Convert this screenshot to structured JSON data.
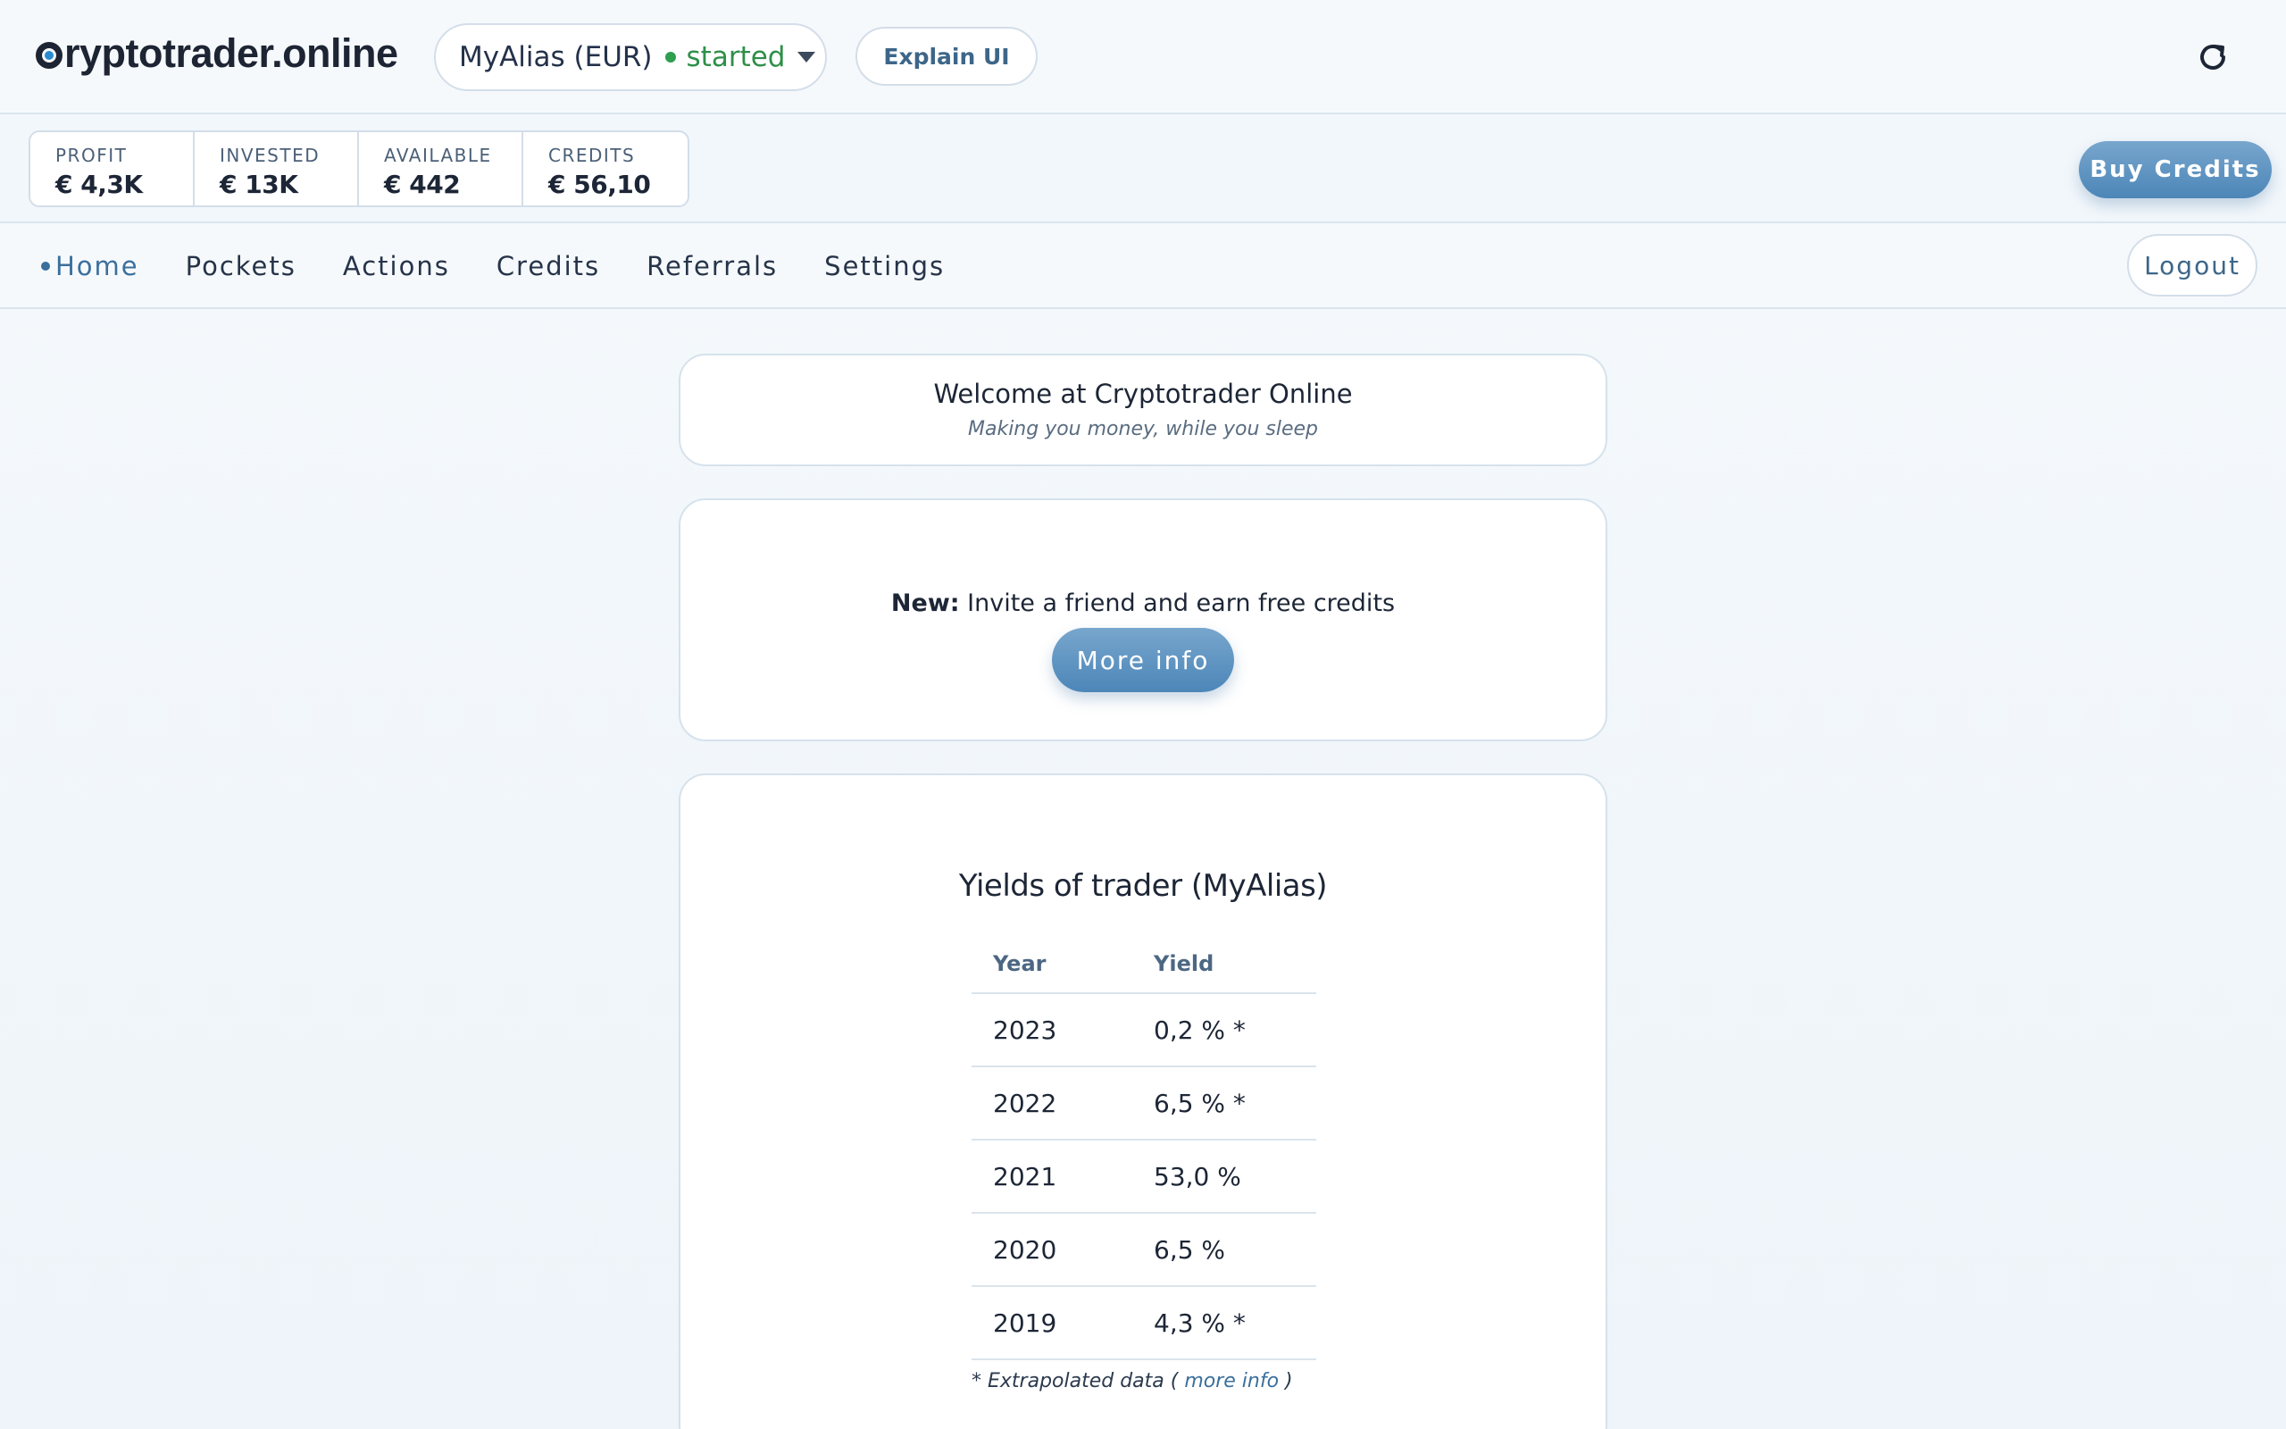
{
  "header": {
    "logo_prefix": "C",
    "logo_rest": "ryptotrader.online",
    "trader_alias": "MyAlias (EUR)",
    "trader_status": "started",
    "explain_label": "Explain UI"
  },
  "stats": [
    {
      "label": "PROFIT",
      "value": "€ 4,3K"
    },
    {
      "label": "INVESTED",
      "value": "€ 13K"
    },
    {
      "label": "AVAILABLE",
      "value": "€ 442"
    },
    {
      "label": "CREDITS",
      "value": "€ 56,10"
    }
  ],
  "buy_credits_label": "Buy Credits",
  "nav": {
    "items": [
      "Home",
      "Pockets",
      "Actions",
      "Credits",
      "Referrals",
      "Settings"
    ],
    "active": "Home",
    "logout_label": "Logout"
  },
  "welcome": {
    "title": "Welcome at Cryptotrader Online",
    "subtitle": "Making you money, while you sleep"
  },
  "invite": {
    "prefix": "New:",
    "text": " Invite a friend and earn free credits",
    "button": "More info"
  },
  "yields": {
    "title": "Yields of trader (MyAlias)",
    "headers": [
      "Year",
      "Yield"
    ],
    "rows": [
      [
        "2023",
        "0,2 % *"
      ],
      [
        "2022",
        "6,5 % *"
      ],
      [
        "2021",
        "53,0 %"
      ],
      [
        "2020",
        "6,5 %"
      ],
      [
        "2019",
        "4,3 % *"
      ]
    ],
    "footnote_prefix": "* Extrapolated data ( ",
    "footnote_link": "more info",
    "footnote_suffix": " )"
  },
  "colors": {
    "accent": "#3a6f9c",
    "status_green": "#2e8f48",
    "button_blue": "#5b91c1"
  },
  "icons": {
    "refresh": "refresh-icon",
    "caret": "chevron-down-icon"
  }
}
